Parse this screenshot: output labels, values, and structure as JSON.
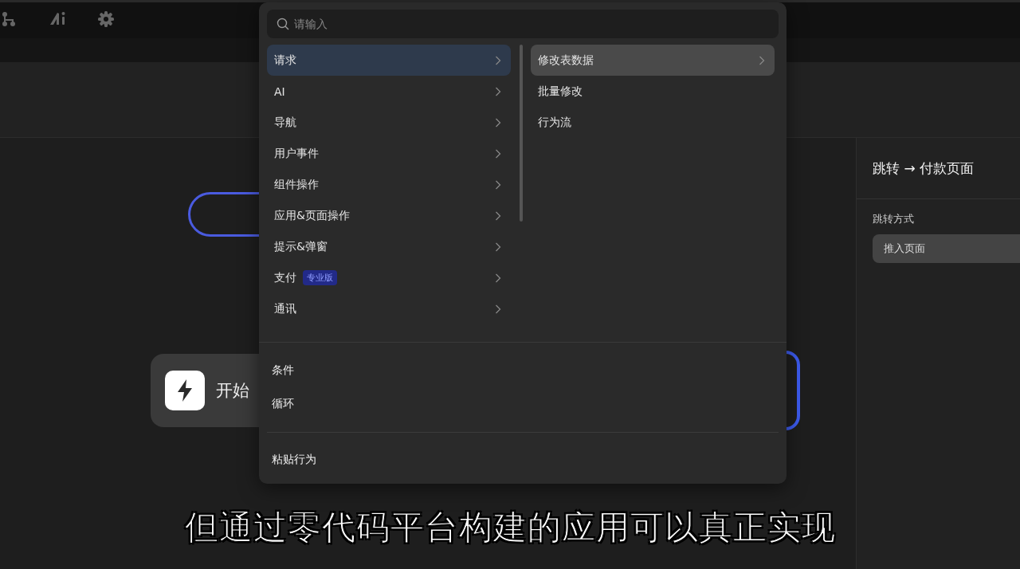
{
  "canvas": {
    "trigger_card": {
      "title": "开始"
    }
  },
  "inspector": {
    "title": "跳转 → 付款页面",
    "field_label": "跳转方式",
    "field_value": "推入页面"
  },
  "action_menu": {
    "search": {
      "placeholder": "请输入"
    },
    "categories": [
      {
        "label": "请求",
        "selected": true
      },
      {
        "label": "AI",
        "selected": false
      },
      {
        "label": "导航",
        "selected": false
      },
      {
        "label": "用户事件",
        "selected": false
      },
      {
        "label": "组件操作",
        "selected": false
      },
      {
        "label": "应用&页面操作",
        "selected": false
      },
      {
        "label": "提示&弹窗",
        "selected": false
      },
      {
        "label": "支付",
        "selected": false,
        "badge": "专业版"
      },
      {
        "label": "通讯",
        "selected": false
      }
    ],
    "actions": [
      {
        "label": "修改表数据",
        "selected": true
      },
      {
        "label": "批量修改",
        "selected": false
      },
      {
        "label": "行为流",
        "selected": false
      }
    ],
    "control_items": [
      "条件",
      "循环"
    ],
    "paste_item": "粘贴行为"
  },
  "subtitle": "但通过零代码平台构建的应用可以真正实现"
}
